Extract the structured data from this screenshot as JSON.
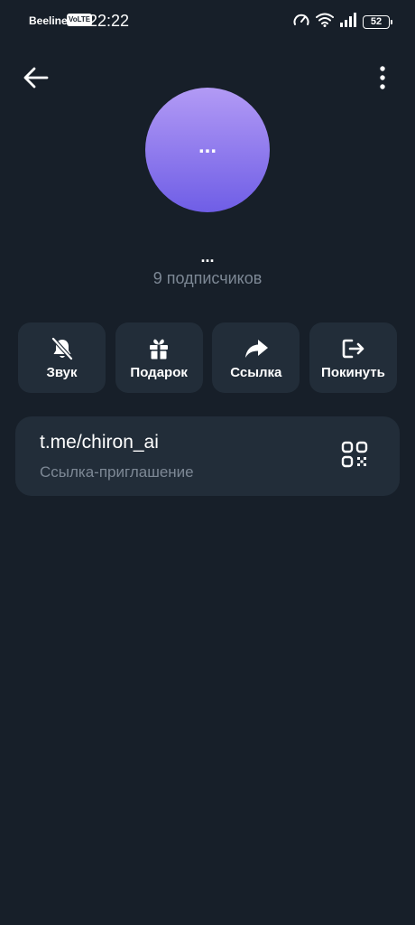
{
  "status_bar": {
    "carrier": "Beeline",
    "network_badge": "VoLTE",
    "time": "22:22",
    "battery": "52",
    "icons": [
      "data-saver-icon",
      "wifi-icon",
      "signal-icon",
      "battery-icon"
    ]
  },
  "header": {
    "back_icon": "arrow-left-icon",
    "more_icon": "more-vertical-icon"
  },
  "profile": {
    "avatar_text": "...",
    "avatar_gradient": [
      "#b29af5",
      "#6f5ee6"
    ],
    "name": "...",
    "subscribers": "9 подписчиков"
  },
  "actions": [
    {
      "label": "Звук",
      "icon": "bell-off-icon"
    },
    {
      "label": "Подарок",
      "icon": "gift-icon"
    },
    {
      "label": "Ссылка",
      "icon": "share-icon"
    },
    {
      "label": "Покинуть",
      "icon": "logout-icon"
    }
  ],
  "invite": {
    "link": "t.me/chiron_ai",
    "caption": "Ссылка-приглашение",
    "qr_icon": "qr-code-icon"
  },
  "colors": {
    "background": "#171f29",
    "card": "#222d39",
    "secondary_text": "#7d8895"
  }
}
